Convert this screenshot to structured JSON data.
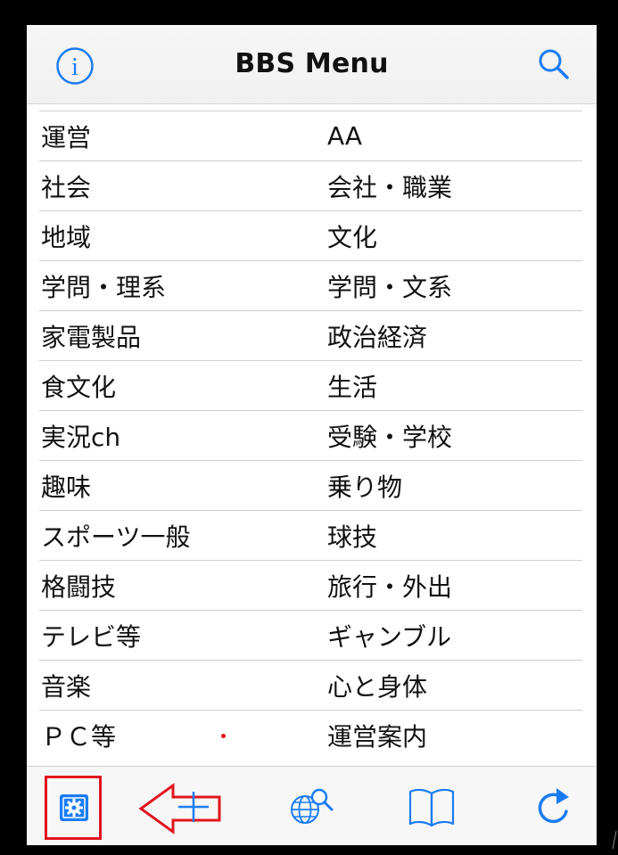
{
  "navbar": {
    "title": "BBS Menu",
    "left_icon": "info-icon",
    "right_icon": "search-icon"
  },
  "menu": {
    "rows": [
      {
        "left": "運営",
        "right": "AA"
      },
      {
        "left": "社会",
        "right": "会社・職業"
      },
      {
        "left": "地域",
        "right": "文化"
      },
      {
        "left": "学問・理系",
        "right": "学問・文系"
      },
      {
        "left": "家電製品",
        "right": "政治経済"
      },
      {
        "left": "食文化",
        "right": "生活"
      },
      {
        "left": "実況ch",
        "right": "受験・学校"
      },
      {
        "left": "趣味",
        "right": "乗り物"
      },
      {
        "left": "スポーツ一般",
        "right": "球技"
      },
      {
        "left": "格闘技",
        "right": "旅行・外出"
      },
      {
        "left": "テレビ等",
        "right": "ギャンブル"
      },
      {
        "left": "音楽",
        "right": "心と身体"
      },
      {
        "left": "ＰＣ等",
        "right": "運営案内"
      }
    ]
  },
  "toolbar": {
    "items": [
      {
        "icon": "settings-icon"
      },
      {
        "icon": "add-icon"
      },
      {
        "icon": "web-search-icon"
      },
      {
        "icon": "bookmarks-icon"
      },
      {
        "icon": "refresh-icon"
      }
    ]
  },
  "colors": {
    "accent": "#1a7cf5",
    "annotation": "#e1141e"
  }
}
